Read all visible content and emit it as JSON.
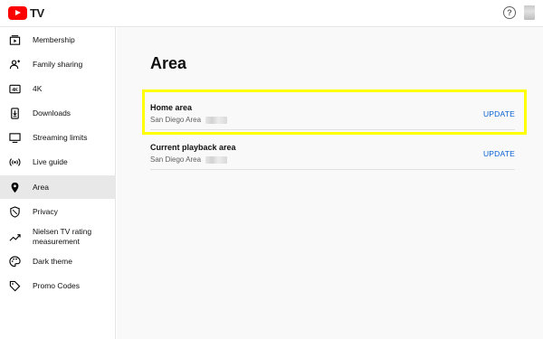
{
  "header": {
    "logo_text": "TV",
    "help_icon": "?"
  },
  "sidebar": {
    "items": [
      {
        "label": "Membership",
        "icon": "membership-icon"
      },
      {
        "label": "Family sharing",
        "icon": "family-icon"
      },
      {
        "label": "4K",
        "icon": "4k-icon"
      },
      {
        "label": "Downloads",
        "icon": "download-icon"
      },
      {
        "label": "Streaming limits",
        "icon": "monitor-icon"
      },
      {
        "label": "Live guide",
        "icon": "broadcast-icon"
      },
      {
        "label": "Area",
        "icon": "location-pin-icon",
        "active": true
      },
      {
        "label": "Privacy",
        "icon": "shield-icon"
      },
      {
        "label": "Nielsen TV rating measurement",
        "icon": "trending-icon"
      },
      {
        "label": "Dark theme",
        "icon": "palette-icon"
      },
      {
        "label": "Promo Codes",
        "icon": "tag-icon"
      }
    ]
  },
  "main": {
    "title": "Area",
    "rows": [
      {
        "title": "Home area",
        "subtitle": "San Diego Area",
        "action": "UPDATE"
      },
      {
        "title": "Current playback area",
        "subtitle": "San Diego Area",
        "action": "UPDATE"
      }
    ]
  },
  "colors": {
    "brand_red": "#ff0000",
    "link_blue": "#065fd4",
    "highlight_yellow": "#ffff00",
    "active_bg": "#e8e8e8"
  }
}
